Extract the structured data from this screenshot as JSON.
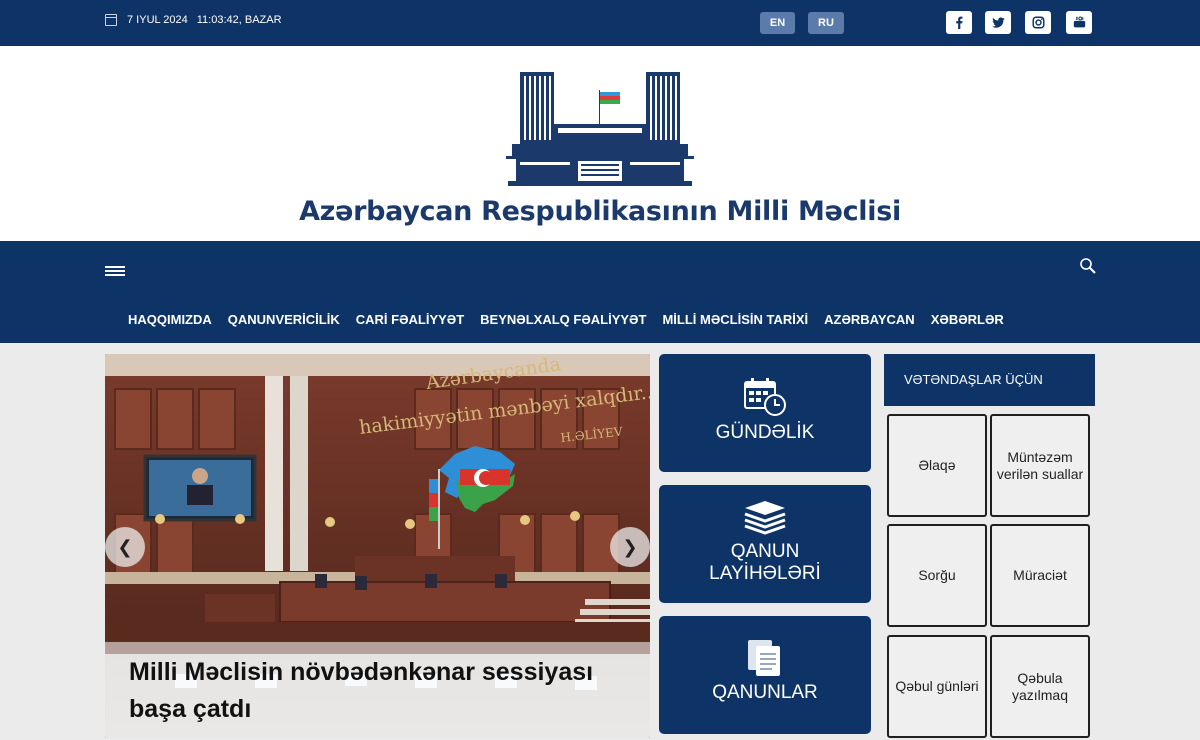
{
  "topbar": {
    "date": "7 IYUL 2024",
    "time": "11:03:42, BAZAR",
    "languages": [
      "EN",
      "RU"
    ],
    "social": [
      "facebook-icon",
      "twitter-icon",
      "instagram-icon",
      "youtube-icon"
    ]
  },
  "header": {
    "title": "Azərbaycan Respublikasının Milli Məclisi"
  },
  "nav": {
    "items": [
      "HAQQIMIZDA",
      "QANUNVERİCİLİK",
      "CARİ FƏALİYYƏT",
      "BEYNƏLXALQ FƏALİYYƏT",
      "MİLLİ MƏCLİSİN TARİXİ",
      "AZƏRBAYCAN",
      "XƏBƏRLƏR"
    ]
  },
  "slider": {
    "wall_text_line1": "Azərbaycanda",
    "wall_text_line2": "hakimiyyətin mənbəyi xalqdır..",
    "wall_text_line3": "H.ƏLİYEV",
    "caption_line1": "Milli Məclisin növbədənkənar sessiyası",
    "caption_line2": "başa çatdı"
  },
  "tiles": {
    "agenda": "GÜNDƏLİK",
    "bills_line1": "QANUN",
    "bills_line2": "LAYİHƏLƏRİ",
    "laws": "QANUNLAR"
  },
  "citizens": {
    "heading": "VƏTƏNDAŞLAR ÜÇÜN",
    "contact": "Əlaqə",
    "faq": "Müntəzəm verilən suallar",
    "inquiry": "Sorğu",
    "appeal": "Müraciət",
    "reception_days": "Qəbul günləri",
    "reception_signup": "Qəbula yazılmaq"
  },
  "colors": {
    "navy": "#0e3467",
    "lang_button": "#5b7bab",
    "panel_bg": "#ebebeb"
  }
}
